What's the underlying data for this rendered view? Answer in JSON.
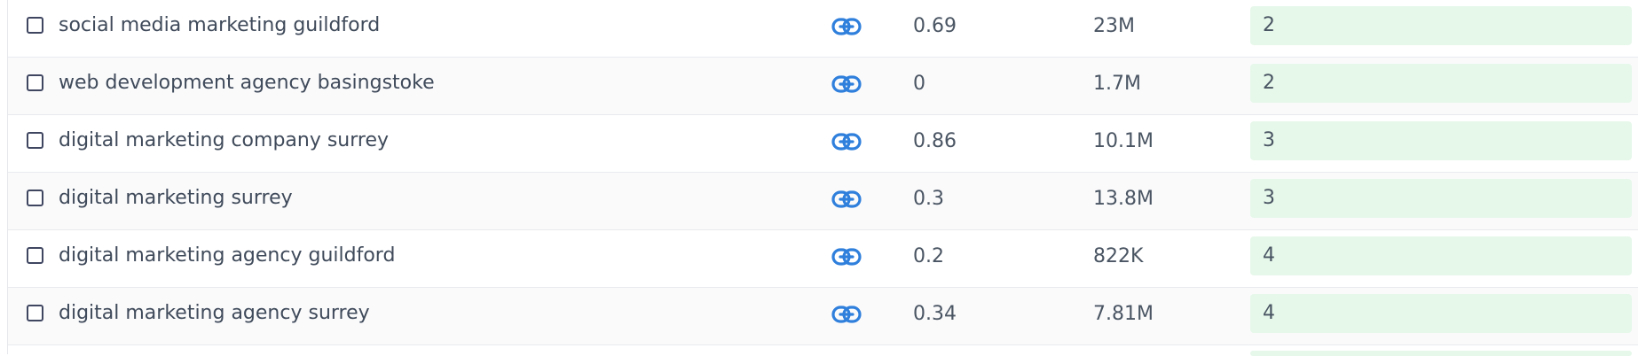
{
  "colors": {
    "link_icon": "#2f7fdc",
    "rank_bg": "#e6f8ea",
    "checkbox_border": "#3f4660"
  },
  "rows": [
    {
      "keyword": "social media marketing guildford",
      "cpc": "0.69",
      "volume": "23M",
      "rank": "2",
      "link_icon": "link-icon"
    },
    {
      "keyword": "web development agency basingstoke",
      "cpc": "0",
      "volume": "1.7M",
      "rank": "2",
      "link_icon": "link-icon"
    },
    {
      "keyword": "digital marketing company surrey",
      "cpc": "0.86",
      "volume": "10.1M",
      "rank": "3",
      "link_icon": "link-icon"
    },
    {
      "keyword": "digital marketing surrey",
      "cpc": "0.3",
      "volume": "13.8M",
      "rank": "3",
      "link_icon": "link-icon"
    },
    {
      "keyword": "digital marketing agency guildford",
      "cpc": "0.2",
      "volume": "822K",
      "rank": "4",
      "link_icon": "link-icon"
    },
    {
      "keyword": "digital marketing agency surrey",
      "cpc": "0.34",
      "volume": "7.81M",
      "rank": "4",
      "link_icon": "link-icon"
    }
  ]
}
